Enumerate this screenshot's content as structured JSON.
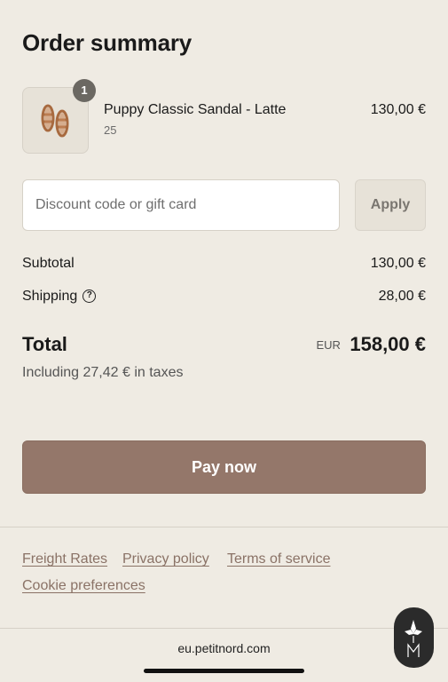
{
  "summary": {
    "title": "Order summary"
  },
  "product": {
    "name": "Puppy Classic Sandal - Latte",
    "variant": "25",
    "price": "130,00 €",
    "quantity": "1",
    "image_icon": "sandal-product-image"
  },
  "discount": {
    "placeholder": "Discount code or gift card",
    "apply_label": "Apply"
  },
  "totals": {
    "subtotal_label": "Subtotal",
    "subtotal_value": "130,00 €",
    "shipping_label": "Shipping",
    "shipping_help_icon": "?",
    "shipping_value": "28,00 €",
    "total_label": "Total",
    "total_currency": "EUR",
    "total_value": "158,00 €",
    "tax_note": "Including 27,42 € in taxes"
  },
  "actions": {
    "pay_label": "Pay now"
  },
  "footer": {
    "links": [
      "Freight Rates",
      "Privacy policy",
      "Terms of service",
      "Cookie preferences"
    ]
  },
  "browser": {
    "domain": "eu.petitnord.com"
  },
  "colors": {
    "background": "#efebe3",
    "pay_button": "#94776a",
    "link": "#8a7266"
  }
}
